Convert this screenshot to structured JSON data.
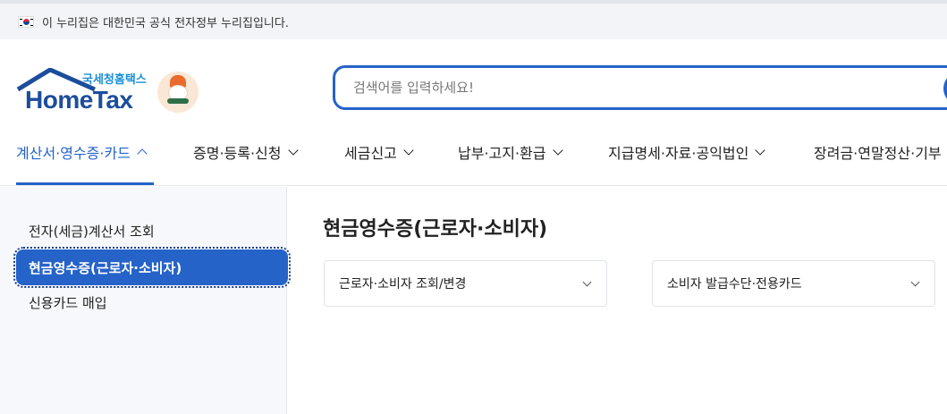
{
  "gov_banner": {
    "text": "이 누리집은 대한민국 공식 전자정부 누리집입니다."
  },
  "logo": {
    "subtitle": "국세청홈택스",
    "name": "HomeTax"
  },
  "search": {
    "placeholder": "검색어를 입력하세요!"
  },
  "nav": {
    "items": [
      {
        "label": "계산서·영수증·카드",
        "active": true
      },
      {
        "label": "증명·등록·신청"
      },
      {
        "label": "세금신고"
      },
      {
        "label": "납부·고지·환급"
      },
      {
        "label": "지급명세·자료·공익법인"
      },
      {
        "label": "장려금·연말정산·기부"
      }
    ]
  },
  "sidebar": {
    "items": [
      {
        "label": "전자(세금)계산서 조회"
      },
      {
        "label": "현금영수증(근로자·소비자)",
        "active": true
      },
      {
        "label": "신용카드 매입"
      }
    ]
  },
  "main": {
    "title": "현금영수증(근로자·소비자)",
    "cards": [
      {
        "label": "근로자·소비자 조회/변경"
      },
      {
        "label": "소비자 발급수단·전용카드"
      }
    ]
  },
  "colors": {
    "accent": "#2563c8",
    "brand_dark": "#1c4d9c",
    "brand_light": "#1a8fd8"
  }
}
